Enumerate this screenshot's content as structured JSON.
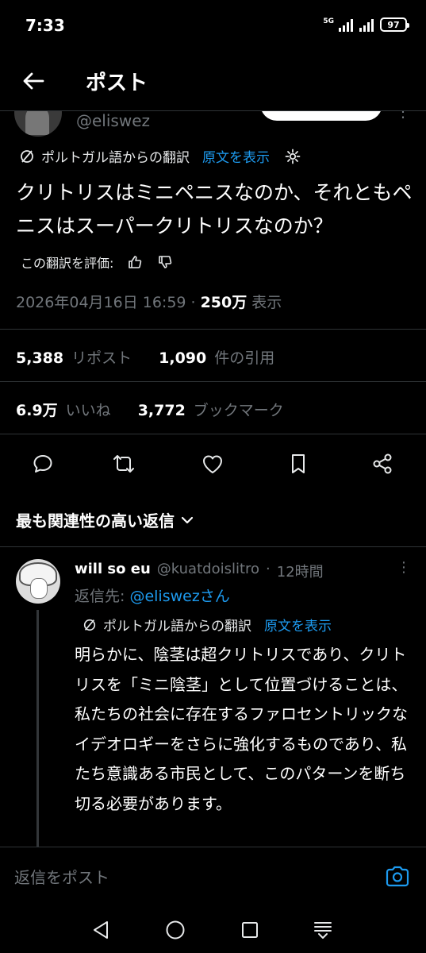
{
  "status": {
    "time": "7:33",
    "network": "5G",
    "battery": "97"
  },
  "header": {
    "title": "ポスト"
  },
  "author": {
    "handle": "@eliswez"
  },
  "translation": {
    "label": "ポルトガル語からの翻訳",
    "show_original": "原文を表示"
  },
  "tweet": {
    "text": "クリトリスはミニペニスなのか、それともペニスはスーパークリトリスなのか？",
    "rate_label": "この翻訳を評価:",
    "datetime": "2026年04月16日 16:59",
    "separator": "·",
    "views_count": "250万",
    "views_label": "表示"
  },
  "stats": {
    "reposts": "5,388",
    "reposts_label": "リポスト",
    "quotes": "1,090",
    "quotes_label": "件の引用",
    "likes": "6.9万",
    "likes_label": "いいね",
    "bookmarks": "3,772",
    "bookmarks_label": "ブックマーク"
  },
  "actions": [
    "reply-icon",
    "repost-icon",
    "like-icon",
    "bookmark-icon",
    "share-icon"
  ],
  "replies_sort": {
    "label": "最も関連性の高い返信"
  },
  "reply": {
    "name": "will so eu",
    "handle": "@kuatdoislitro",
    "separator": "·",
    "time": "12時間",
    "reply_to_label": "返信先:",
    "reply_to_user": "@eliswezさん",
    "translation_label": "ポルトガル語からの翻訳",
    "show_original": "原文を表示",
    "text": "明らかに、陰茎は超クリトリスであり、クリトリスを「ミニ陰茎」として位置づけることは、私たちの社会に存在するファロセントリックなイデオロギーをさらに強化するものであり、私たち意識ある市民として、このパターンを断ち切る必要があります。"
  },
  "composer": {
    "placeholder": "返信をポスト"
  },
  "colors": {
    "background": "#000000",
    "accent": "#1d9bf0",
    "muted": "#71767b",
    "text": "#e7e9ea"
  }
}
